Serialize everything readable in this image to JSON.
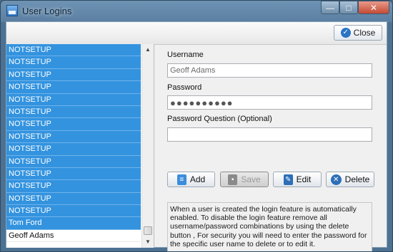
{
  "window": {
    "title": "User Logins",
    "caption": {
      "minimize": "—",
      "maximize": "□",
      "close": "✕"
    }
  },
  "toolbar": {
    "close_label": "Close"
  },
  "users": [
    "NOTSETUP",
    "NOTSETUP",
    "NOTSETUP",
    "NOTSETUP",
    "NOTSETUP",
    "NOTSETUP",
    "NOTSETUP",
    "NOTSETUP",
    "NOTSETUP",
    "NOTSETUP",
    "NOTSETUP",
    "NOTSETUP",
    "NOTSETUP",
    "NOTSETUP",
    "Tom Ford",
    "Geoff Adams"
  ],
  "form": {
    "username_label": "Username",
    "username_value": "Geoff Adams",
    "password_label": "Password",
    "password_value": "●●●●●●●●●●",
    "question_label": "Password Question (Optional)",
    "question_value": ""
  },
  "buttons": {
    "add": "Add",
    "save": "Save",
    "edit": "Edit",
    "delete": "Delete"
  },
  "info_text": "When a user is created the login feature is automatically enabled. To disable the login feature remove all username/password combinations by using the delete button , For security you will need to enter the password for the specific user name to delete or to edit it."
}
